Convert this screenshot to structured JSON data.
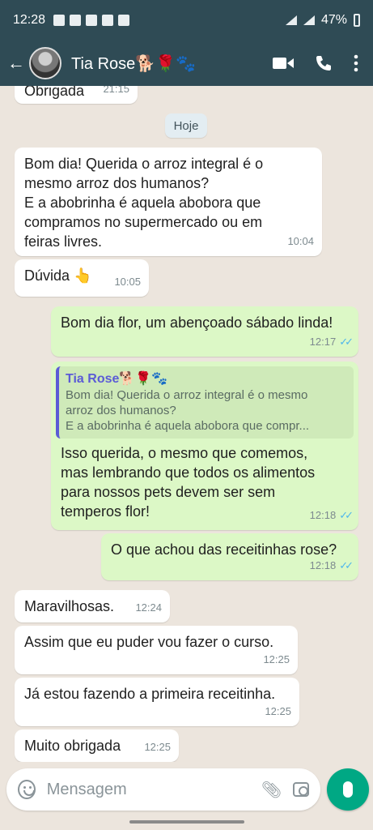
{
  "status_bar": {
    "time": "12:28",
    "battery": "47%"
  },
  "header": {
    "contact_name": "Tia Rose🐕🌹🐾"
  },
  "chat": {
    "day_label": "Hoje",
    "messages": [
      {
        "dir": "in",
        "text": "Obrigada",
        "time": "21:15"
      },
      {
        "dir": "in",
        "text": "Bom dia! Querida o arroz integral é o\nmesmo arroz dos humanos?\nE a abobrinha é aquela abobora que\ncompramos no supermercado ou em\nfeiras livres.",
        "time": "10:04"
      },
      {
        "dir": "in",
        "text": "Dúvida 👆",
        "time": "10:05"
      },
      {
        "dir": "out",
        "text": "Bom dia flor, um abençoado sábado linda!",
        "time": "12:17"
      },
      {
        "dir": "out",
        "quote": {
          "name": "Tia Rose🐕🌹🐾",
          "text": "Bom dia! Querida o arroz integral é o mesmo\narroz dos humanos?\nE a abobrinha é aquela abobora que compr..."
        },
        "text": "Isso querida, o mesmo que comemos,\nmas lembrando que todos os alimentos\npara nossos pets devem ser sem\ntemperos flor!",
        "time": "12:18"
      },
      {
        "dir": "out",
        "text": "O que achou das receitinhas rose?",
        "time": "12:18"
      },
      {
        "dir": "in",
        "text": "Maravilhosas.",
        "time": "12:24"
      },
      {
        "dir": "in",
        "text": "Assim que eu puder vou fazer o curso.",
        "time": "12:25"
      },
      {
        "dir": "in",
        "text": "Já estou fazendo a primeira receitinha.",
        "time": "12:25"
      },
      {
        "dir": "in",
        "text": "Muito obrigada",
        "time": "12:25"
      }
    ]
  },
  "composer": {
    "placeholder": "Mensagem"
  },
  "colors": {
    "header": "#2F4B55",
    "incoming": "#FFFFFF",
    "outgoing": "#DCF8C6",
    "mic": "#00A884",
    "read_ticks": "#4FB6EC"
  }
}
